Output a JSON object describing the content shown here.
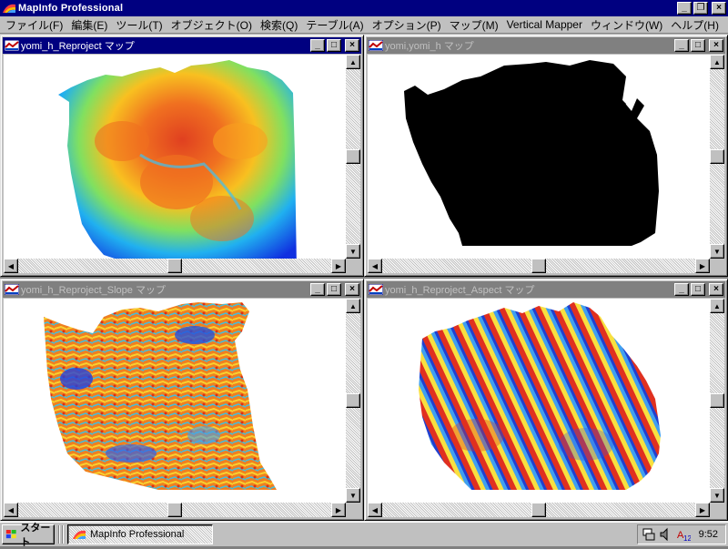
{
  "app": {
    "title": "MapInfo Professional",
    "colors": {
      "titlebar": "#000080",
      "face": "#c0c0c0",
      "workspace": "#808080"
    }
  },
  "menu": [
    "ファイル(F)",
    "編集(E)",
    "ツール(T)",
    "オブジェクト(O)",
    "検索(Q)",
    "テーブル(A)",
    "オプション(P)",
    "マップ(M)",
    "Vertical Mapper",
    "ウィンドウ(W)",
    "ヘルプ(H)"
  ],
  "windows": [
    {
      "title": "yomi_h_Reproject マップ",
      "active": true,
      "map": "elevation"
    },
    {
      "title": "yomi,yomi_h マップ",
      "active": false,
      "map": "mask"
    },
    {
      "title": "yomi_h_Reproject_Slope マップ",
      "active": false,
      "map": "slope"
    },
    {
      "title": "yomi_h_Reproject_Aspect マップ",
      "active": false,
      "map": "aspect"
    }
  ],
  "taskbar": {
    "start_label": "スタート",
    "task_label": "MapInfo Professional",
    "clock": "9:52",
    "tray_icons": [
      "network-icon",
      "volume-icon",
      "ime-icon"
    ]
  }
}
